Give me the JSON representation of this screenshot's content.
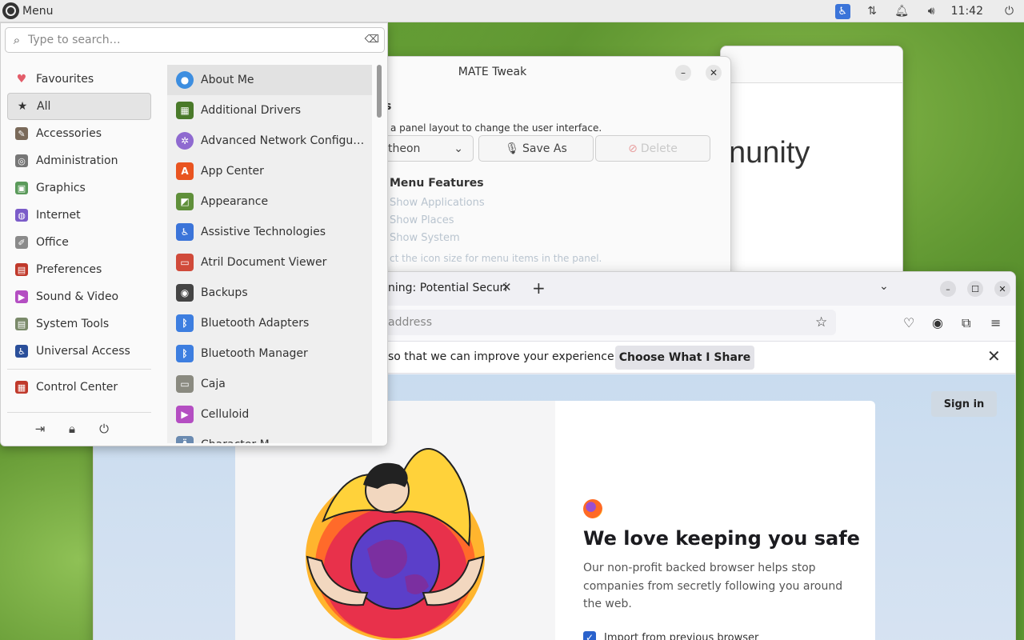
{
  "panel": {
    "menu_label": "Menu",
    "clock": "11:42"
  },
  "menu": {
    "search_placeholder": "Type to search…",
    "categories": [
      {
        "label": "Favourites",
        "icon": "heart-icon",
        "color": "#e35d6a"
      },
      {
        "label": "All",
        "icon": "star-icon",
        "color": "#333333"
      },
      {
        "label": "Accessories",
        "icon": "accessories-icon",
        "color": "#7a6a5a"
      },
      {
        "label": "Administration",
        "icon": "administration-icon",
        "color": "#777777"
      },
      {
        "label": "Graphics",
        "icon": "graphics-icon",
        "color": "#5a9a5a"
      },
      {
        "label": "Internet",
        "icon": "internet-icon",
        "color": "#7b5cc9"
      },
      {
        "label": "Office",
        "icon": "office-icon",
        "color": "#8a8a8a"
      },
      {
        "label": "Preferences",
        "icon": "preferences-icon",
        "color": "#c0392b"
      },
      {
        "label": "Sound & Video",
        "icon": "sound-video-icon",
        "color": "#b44ec2"
      },
      {
        "label": "System Tools",
        "icon": "system-tools-icon",
        "color": "#7a8a6a"
      },
      {
        "label": "Universal Access",
        "icon": "universal-access-icon",
        "color": "#2a4f9a"
      }
    ],
    "control_center": "Control Center",
    "apps": [
      {
        "label": "About Me",
        "icon": "user-icon",
        "color": "#3d8ee0"
      },
      {
        "label": "Additional Drivers",
        "icon": "chip-icon",
        "color": "#4a7a2a"
      },
      {
        "label": "Advanced Network Configu…",
        "icon": "network-icon",
        "color": "#8f6ad0"
      },
      {
        "label": "App Center",
        "icon": "app-center-icon",
        "color": "#e95420"
      },
      {
        "label": "Appearance",
        "icon": "appearance-icon",
        "color": "#5f8f3a"
      },
      {
        "label": "Assistive Technologies",
        "icon": "accessibility-icon",
        "color": "#3b74d9"
      },
      {
        "label": "Atril Document Viewer",
        "icon": "document-viewer-icon",
        "color": "#d04a3a"
      },
      {
        "label": "Backups",
        "icon": "backups-icon",
        "color": "#444444"
      },
      {
        "label": "Bluetooth Adapters",
        "icon": "bluetooth-icon",
        "color": "#3d7ee0"
      },
      {
        "label": "Bluetooth Manager",
        "icon": "bluetooth-icon",
        "color": "#3d7ee0"
      },
      {
        "label": "Caja",
        "icon": "folder-icon",
        "color": "#8a8a80"
      },
      {
        "label": "Celluloid",
        "icon": "play-icon",
        "color": "#b44ec2"
      },
      {
        "label": "Character M…",
        "icon": "character-map-icon",
        "color": "#6a8ab0"
      }
    ]
  },
  "tweak": {
    "title": "MATE Tweak",
    "heading_fragment": "s",
    "subtitle": "a panel layout to change the user interface.",
    "layout_value": "theon",
    "save_as": "Save As",
    "delete": "Delete",
    "features_title": "Menu Features",
    "features": [
      "Show Applications",
      "Show Places",
      "Show System"
    ],
    "icon_size_text": "ct the icon size for menu items in the panel."
  },
  "bgwin": {
    "text": "nunity"
  },
  "browser": {
    "tab_title": "ning: Potential Securi",
    "address_placeholder": "address",
    "notification": "so that we can improve your experience.",
    "choose_share": "Choose What I Share",
    "sign_in": "Sign in",
    "heading": "We love keeping you safe",
    "description": "Our non-profit backed browser helps stop companies from secretly following you around the web.",
    "checkbox_label": "Import from previous browser"
  }
}
